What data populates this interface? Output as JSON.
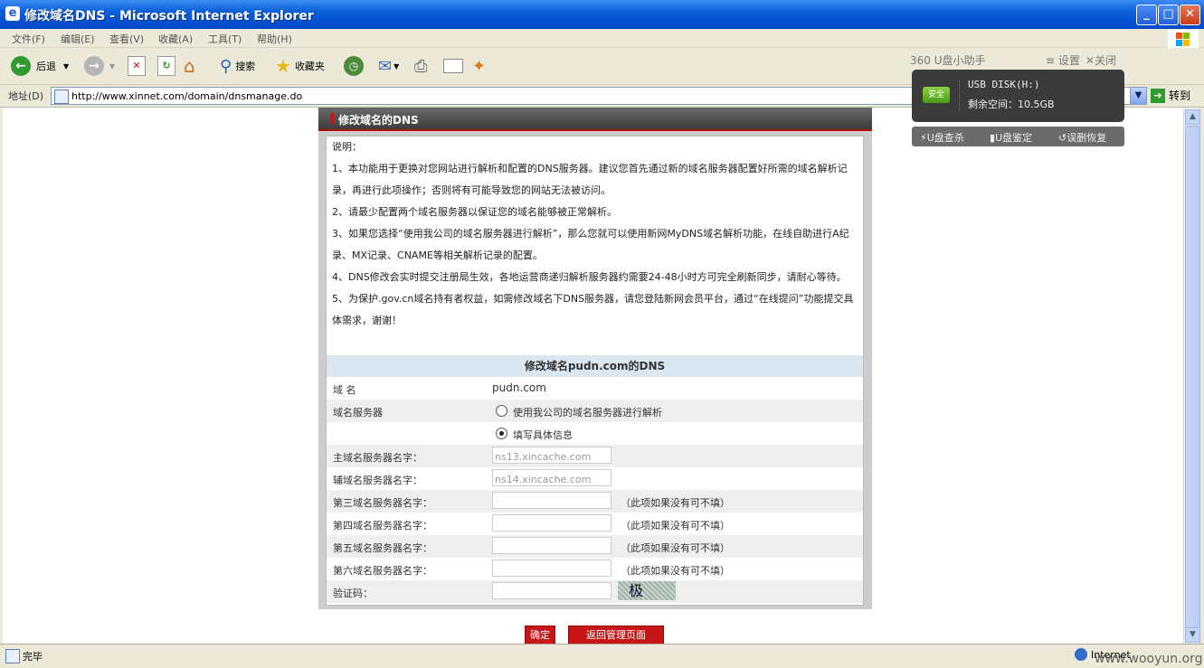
{
  "window": {
    "title": "修改域名DNS - Microsoft Internet Explorer"
  },
  "menu": [
    "文件(F)",
    "编辑(E)",
    "查看(V)",
    "收藏(A)",
    "工具(T)",
    "帮助(H)"
  ],
  "toolbar": {
    "back": "后退",
    "search": "搜索",
    "favorites": "收藏夹"
  },
  "address": {
    "label": "地址(D)",
    "url": "http://www.xinnet.com/domain/dnsmanage.do",
    "go": "转到"
  },
  "page": {
    "panel_title": "修改域名的DNS",
    "notes": [
      "说明：",
      "1、本功能用于更换对您网站进行解析和配置的DNS服务器。建议您首先通过新的域名服务器配置好所需的域名解析记录，再进行此项操作；否则将有可能导致您的网站无法被访问。",
      "2、请最少配置两个域名服务器以保证您的域名能够被正常解析。",
      "3、如果您选择“使用我公司的域名服务器进行解析”，那么您就可以使用新网MyDNS域名解析功能，在线自助进行A纪录、MX记录、CNAME等相关解析记录的配置。",
      "4、DNS修改会实时提交注册局生效，各地运营商递归解析服务器约需要24-48小时方可完全刷新同步，请耐心等待。",
      "5、为保护.gov.cn域名持有者权益，如需修改域名下DNS服务器，请您登陆新网会员平台，通过“在线提问”功能提交具体需求，谢谢！"
    ],
    "form_title": "修改域名pudn.com的DNS",
    "domain_label": "域 名",
    "domain_value": "pudn.com",
    "dns_server_label": "域名服务器",
    "radio_use_ours": "使用我公司的域名服务器进行解析",
    "radio_custom": "填写具体信息",
    "ns_fields": [
      {
        "label": "主域名服务器名字：",
        "value": "ns13.xincache.com",
        "hint": ""
      },
      {
        "label": "辅域名服务器名字：",
        "value": "ns14.xincache.com",
        "hint": ""
      },
      {
        "label": "第三域名服务器名字：",
        "value": "",
        "hint": "（此项如果没有可不填）"
      },
      {
        "label": "第四域名服务器名字：",
        "value": "",
        "hint": "（此项如果没有可不填）"
      },
      {
        "label": "第五域名服务器名字：",
        "value": "",
        "hint": "（此项如果没有可不填）"
      },
      {
        "label": "第六域名服务器名字：",
        "value": "",
        "hint": "（此项如果没有可不填）"
      }
    ],
    "captcha_label": "验证码：",
    "captcha_text": "极",
    "confirm_button": "确定",
    "back_button": "返回管理页面"
  },
  "u_disk": {
    "title": "360 U盘小助手",
    "settings": "设置",
    "close": "关闭",
    "safe_badge": "安全",
    "disk_name": "USB DISK(H:)",
    "free_space": "剩余空间：10.5GB",
    "actions": [
      "U盘查杀",
      "U盘鉴定",
      "误删恢复"
    ]
  },
  "status": {
    "text": "完毕",
    "zone": "Internet",
    "watermark": "www.wooyun.org"
  }
}
